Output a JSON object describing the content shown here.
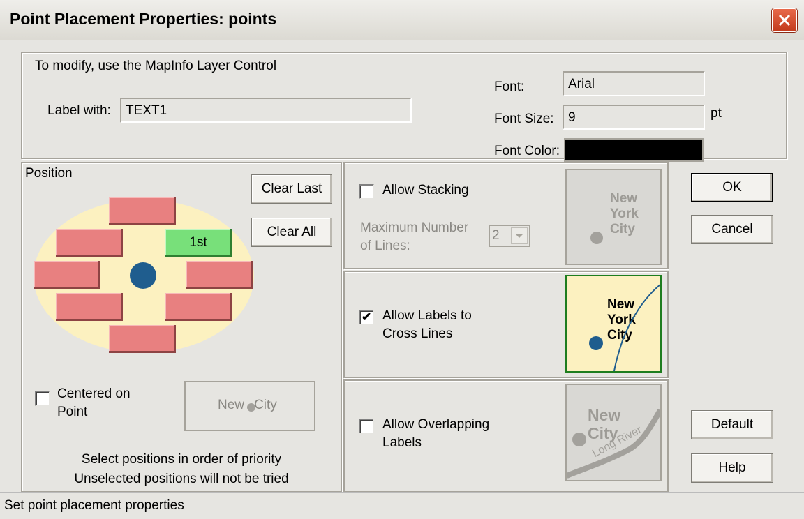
{
  "window": {
    "title": "Point Placement Properties: points"
  },
  "top_panel": {
    "note": "To modify, use the MapInfo Layer Control",
    "label_with": {
      "label": "Label with:",
      "value": "TEXT1"
    },
    "font": {
      "label": "Font:",
      "value": "Arial"
    },
    "font_size": {
      "label": "Font Size:",
      "value": "9",
      "unit": "pt"
    },
    "font_color": {
      "label": "Font Color:",
      "value": "#000000"
    }
  },
  "position_panel": {
    "title": "Position",
    "clear_last": "Clear Last",
    "clear_all": "Clear All",
    "first_marker": "1st",
    "centered_on_point": {
      "label_line1": "Centered on",
      "label_line2": "Point",
      "checked": false
    },
    "preview_text_left": "New",
    "preview_text_right": "City",
    "hint_line1": "Select positions in order of priority",
    "hint_line2": "Unselected positions will not be tried"
  },
  "stacking_panel": {
    "allow_stacking": {
      "label": "Allow Stacking",
      "checked": false
    },
    "max_lines_label_line1": "Maximum Number",
    "max_lines_label_line2": "of Lines:",
    "max_lines_value": "2",
    "preview": [
      "New",
      "York",
      "City"
    ]
  },
  "cross_lines_panel": {
    "allow_cross": {
      "label_line1": "Allow Labels to",
      "label_line2": "Cross Lines",
      "checked": true
    },
    "preview": [
      "New",
      "York",
      "City"
    ]
  },
  "overlap_panel": {
    "allow_overlap": {
      "label_line1": "Allow Overlapping",
      "label_line2": "Labels",
      "checked": false
    },
    "preview_words": [
      "New",
      "City",
      "Long River"
    ]
  },
  "buttons": {
    "ok": "OK",
    "cancel": "Cancel",
    "default": "Default",
    "help": "Help"
  },
  "status_bar": {
    "text": "Set point placement properties"
  },
  "colors": {
    "preview_bg": "#fcf1c0",
    "red_position": "#e88080",
    "green_position": "#78e07a",
    "point": "#1f5d8e"
  }
}
